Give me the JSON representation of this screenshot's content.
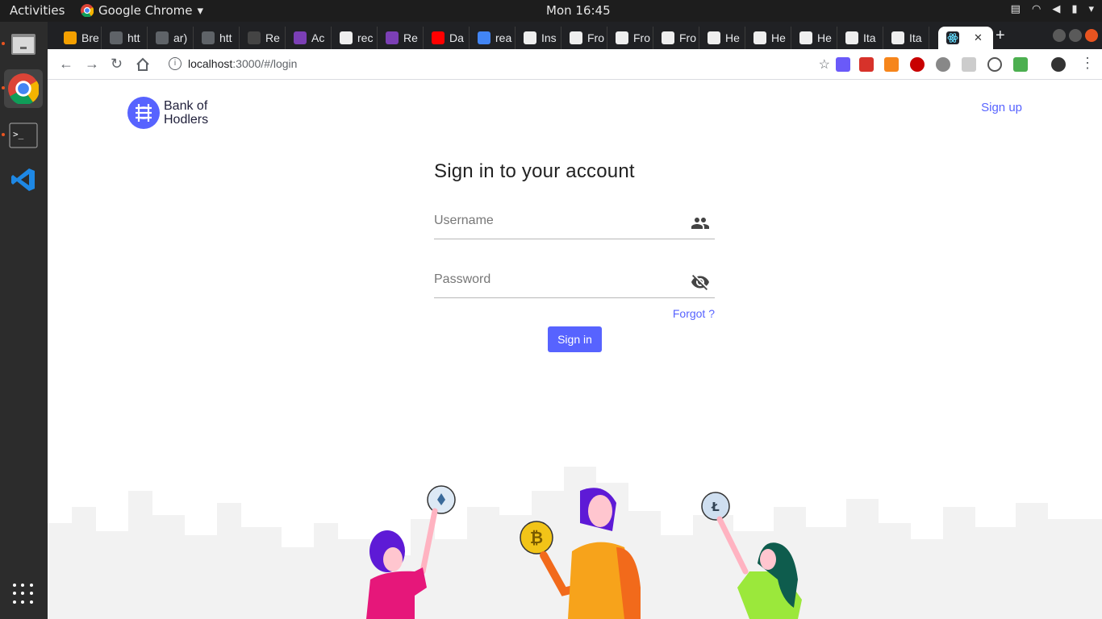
{
  "os": {
    "activities": "Activities",
    "app_menu": "Google Chrome",
    "clock": "Mon 16:45"
  },
  "browser": {
    "tabs": [
      {
        "label": "Bre",
        "color": "#f4a000"
      },
      {
        "label": "htt",
        "color": "#5f6368"
      },
      {
        "label": "ar)",
        "color": "#5f6368"
      },
      {
        "label": "htt",
        "color": "#5f6368"
      },
      {
        "label": "Re",
        "color": "#444"
      },
      {
        "label": "Ac",
        "color": "#7b3fb5"
      },
      {
        "label": "rec",
        "color": "#eee"
      },
      {
        "label": "Re",
        "color": "#7b3fb5"
      },
      {
        "label": "Da",
        "color": "#ff0000"
      },
      {
        "label": "rea",
        "color": "#4285f4"
      },
      {
        "label": "Ins",
        "color": "#eee"
      },
      {
        "label": "Fro",
        "color": "#eee"
      },
      {
        "label": "Fro",
        "color": "#eee"
      },
      {
        "label": "Fro",
        "color": "#eee"
      },
      {
        "label": "He",
        "color": "#eee"
      },
      {
        "label": "He",
        "color": "#eee"
      },
      {
        "label": "He",
        "color": "#eee"
      },
      {
        "label": "Ita",
        "color": "#eee"
      },
      {
        "label": "Ita",
        "color": "#eee"
      }
    ],
    "active_tab_close": "✕",
    "new_tab": "+",
    "url_host": "localhost",
    "url_path": ":3000/#/login"
  },
  "page": {
    "brand_line1": "Bank of",
    "brand_line2": "Hodlers",
    "signup": "Sign up",
    "heading": "Sign in to your account",
    "username_placeholder": "Username",
    "password_placeholder": "Password",
    "forgot": "Forgot ?",
    "signin": "Sign in"
  },
  "colors": {
    "accent": "#5763ff",
    "brand_dark": "#1f1f3a"
  }
}
